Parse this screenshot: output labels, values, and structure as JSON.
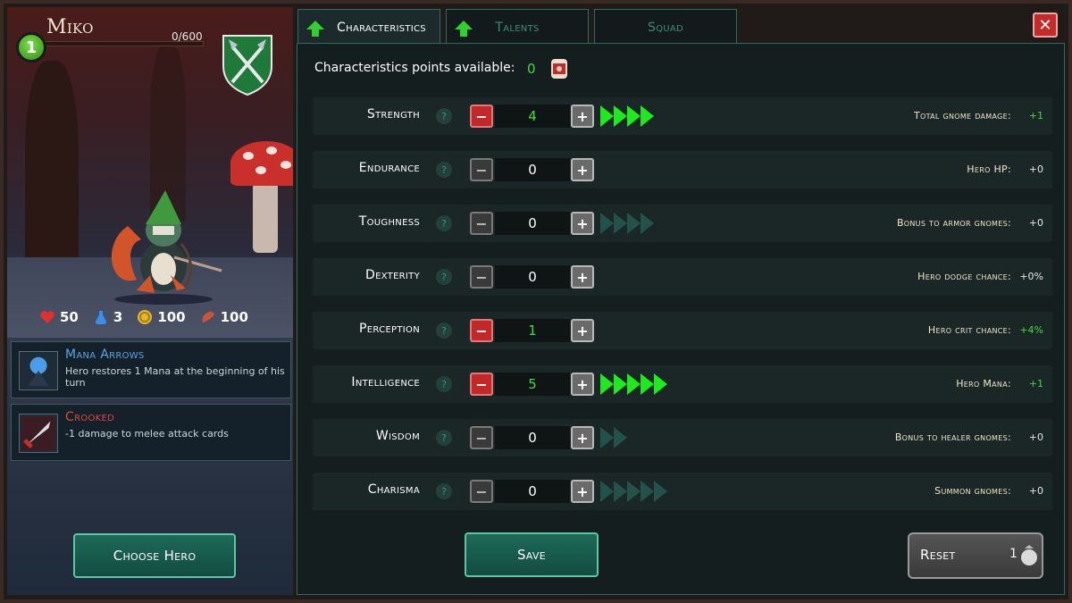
{
  "hero": {
    "name": "Miko",
    "level": "1",
    "xp": "0/600"
  },
  "resources": [
    {
      "icon": "heart-icon",
      "value": "50"
    },
    {
      "icon": "mana-potion-icon",
      "value": "3"
    },
    {
      "icon": "gold-coin-icon",
      "value": "100"
    },
    {
      "icon": "meat-icon",
      "value": "100"
    }
  ],
  "perks": [
    {
      "icon": "mana-arrows-icon",
      "title": "Mana Arrows",
      "title_color": "#5aa6e8",
      "desc": "Hero restores 1 Mana at the beginning of his turn"
    },
    {
      "icon": "crooked-sword-icon",
      "title": "Crooked",
      "title_color": "#e04a3a",
      "desc": "-1 damage to melee attack cards"
    }
  ],
  "choose_hero_label": "Choose Hero",
  "tabs": [
    {
      "label": "Characteristics",
      "active": true
    },
    {
      "label": "Talents",
      "active": false
    },
    {
      "label": "Squad",
      "active": false
    }
  ],
  "points": {
    "label": "Characteristics points available:",
    "value": "0"
  },
  "stats": [
    {
      "name": "Strength",
      "value": "4",
      "effect": "Total gnome damage:",
      "effect_value": "+1",
      "minus_active": true,
      "arrows_total": 4,
      "arrows_lit": 4
    },
    {
      "name": "Endurance",
      "value": "0",
      "effect": "Hero HP:",
      "effect_value": "+0",
      "minus_active": false,
      "arrows_total": 0,
      "arrows_lit": 0
    },
    {
      "name": "Toughness",
      "value": "0",
      "effect": "Bonus to armor gnomes:",
      "effect_value": "+0",
      "minus_active": false,
      "arrows_total": 4,
      "arrows_lit": 0
    },
    {
      "name": "Dexterity",
      "value": "0",
      "effect": "Hero dodge chance:",
      "effect_value": "+0%",
      "minus_active": false,
      "arrows_total": 0,
      "arrows_lit": 0
    },
    {
      "name": "Perception",
      "value": "1",
      "effect": "Hero crit chance:",
      "effect_value": "+4%",
      "minus_active": true,
      "arrows_total": 0,
      "arrows_lit": 0
    },
    {
      "name": "Intelligence",
      "value": "5",
      "effect": "Hero Mana:",
      "effect_value": "+1",
      "minus_active": true,
      "arrows_total": 5,
      "arrows_lit": 5
    },
    {
      "name": "Wisdom",
      "value": "0",
      "effect": "Bonus to healer gnomes:",
      "effect_value": "+0",
      "minus_active": false,
      "arrows_total": 2,
      "arrows_lit": 0
    },
    {
      "name": "Charisma",
      "value": "0",
      "effect": "Summon gnomes:",
      "effect_value": "+0",
      "minus_active": false,
      "arrows_total": 5,
      "arrows_lit": 0
    }
  ],
  "save_label": "Save",
  "reset": {
    "label": "Reset",
    "cost": "1"
  },
  "colors": {
    "accent_green": "#3fdb3f",
    "panel_border": "#2f6a5e",
    "close_red": "#c42c2c"
  }
}
